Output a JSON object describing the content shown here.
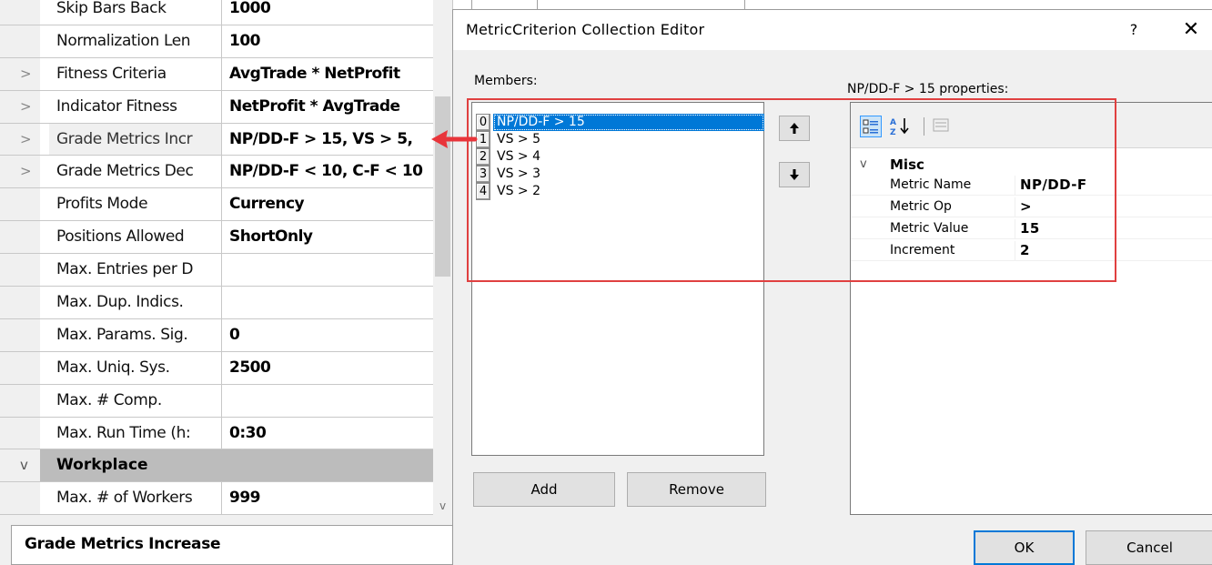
{
  "grid": {
    "rows": [
      {
        "name": "Skip Bars Back",
        "value": "1000",
        "expander": ""
      },
      {
        "name": "Normalization Len",
        "value": "100",
        "expander": ""
      },
      {
        "name": "Fitness Criteria",
        "value": "AvgTrade * NetProfit",
        "expander": ">"
      },
      {
        "name": "Indicator Fitness",
        "value": "NetProfit * AvgTrade",
        "expander": ">"
      },
      {
        "name": "Grade Metrics Incr",
        "value": "NP/DD-F > 15, VS > 5,",
        "expander": ">"
      },
      {
        "name": "Grade Metrics Dec",
        "value": "NP/DD-F < 10, C-F < 10",
        "expander": ">"
      },
      {
        "name": "Profits Mode",
        "value": "Currency",
        "expander": ""
      },
      {
        "name": "Positions Allowed",
        "value": "ShortOnly",
        "expander": ""
      },
      {
        "name": "Max. Entries per D",
        "value": "",
        "expander": ""
      },
      {
        "name": "Max. Dup. Indics.",
        "value": "",
        "expander": ""
      },
      {
        "name": "Max. Params. Sig.",
        "value": "0",
        "expander": ""
      },
      {
        "name": "Max. Uniq. Sys.",
        "value": "2500",
        "expander": ""
      },
      {
        "name": "Max. # Comp.",
        "value": "",
        "expander": ""
      },
      {
        "name": "Max. Run Time (h:",
        "value": "0:30",
        "expander": ""
      }
    ],
    "category": {
      "label": "Workplace",
      "expander": "v"
    },
    "last_row": {
      "name": "Max. # of Workers",
      "value": "999"
    },
    "description_title": "Grade Metrics Increase",
    "scroll_down_glyph": "v"
  },
  "dialog": {
    "title": "MetricCriterion Collection Editor",
    "help_label": "?",
    "close_label": "✕",
    "members_label": "Members:",
    "members": [
      {
        "index": "0",
        "label": "NP/DD-F > 15"
      },
      {
        "index": "1",
        "label": "VS > 5"
      },
      {
        "index": "2",
        "label": "VS > 4"
      },
      {
        "index": "3",
        "label": "VS > 3"
      },
      {
        "index": "4",
        "label": "VS > 2"
      }
    ],
    "move_up_glyph": "🠉",
    "move_down_glyph": "🠋",
    "add_label": "Add",
    "remove_label": "Remove",
    "properties_label": "NP/DD-F > 15 properties:",
    "category": {
      "label": "Misc",
      "expander": "v"
    },
    "properties": [
      {
        "name": "Metric Name",
        "value": "NP/DD-F"
      },
      {
        "name": "Metric Op",
        "value": ">"
      },
      {
        "name": "Metric Value",
        "value": "15"
      },
      {
        "name": "Increment",
        "value": "2"
      }
    ],
    "ok_label": "OK",
    "cancel_label": "Cancel"
  },
  "colors": {
    "selection": "#0078d7",
    "highlight_box": "#e04040",
    "callout_arrow": "#e8343a"
  }
}
